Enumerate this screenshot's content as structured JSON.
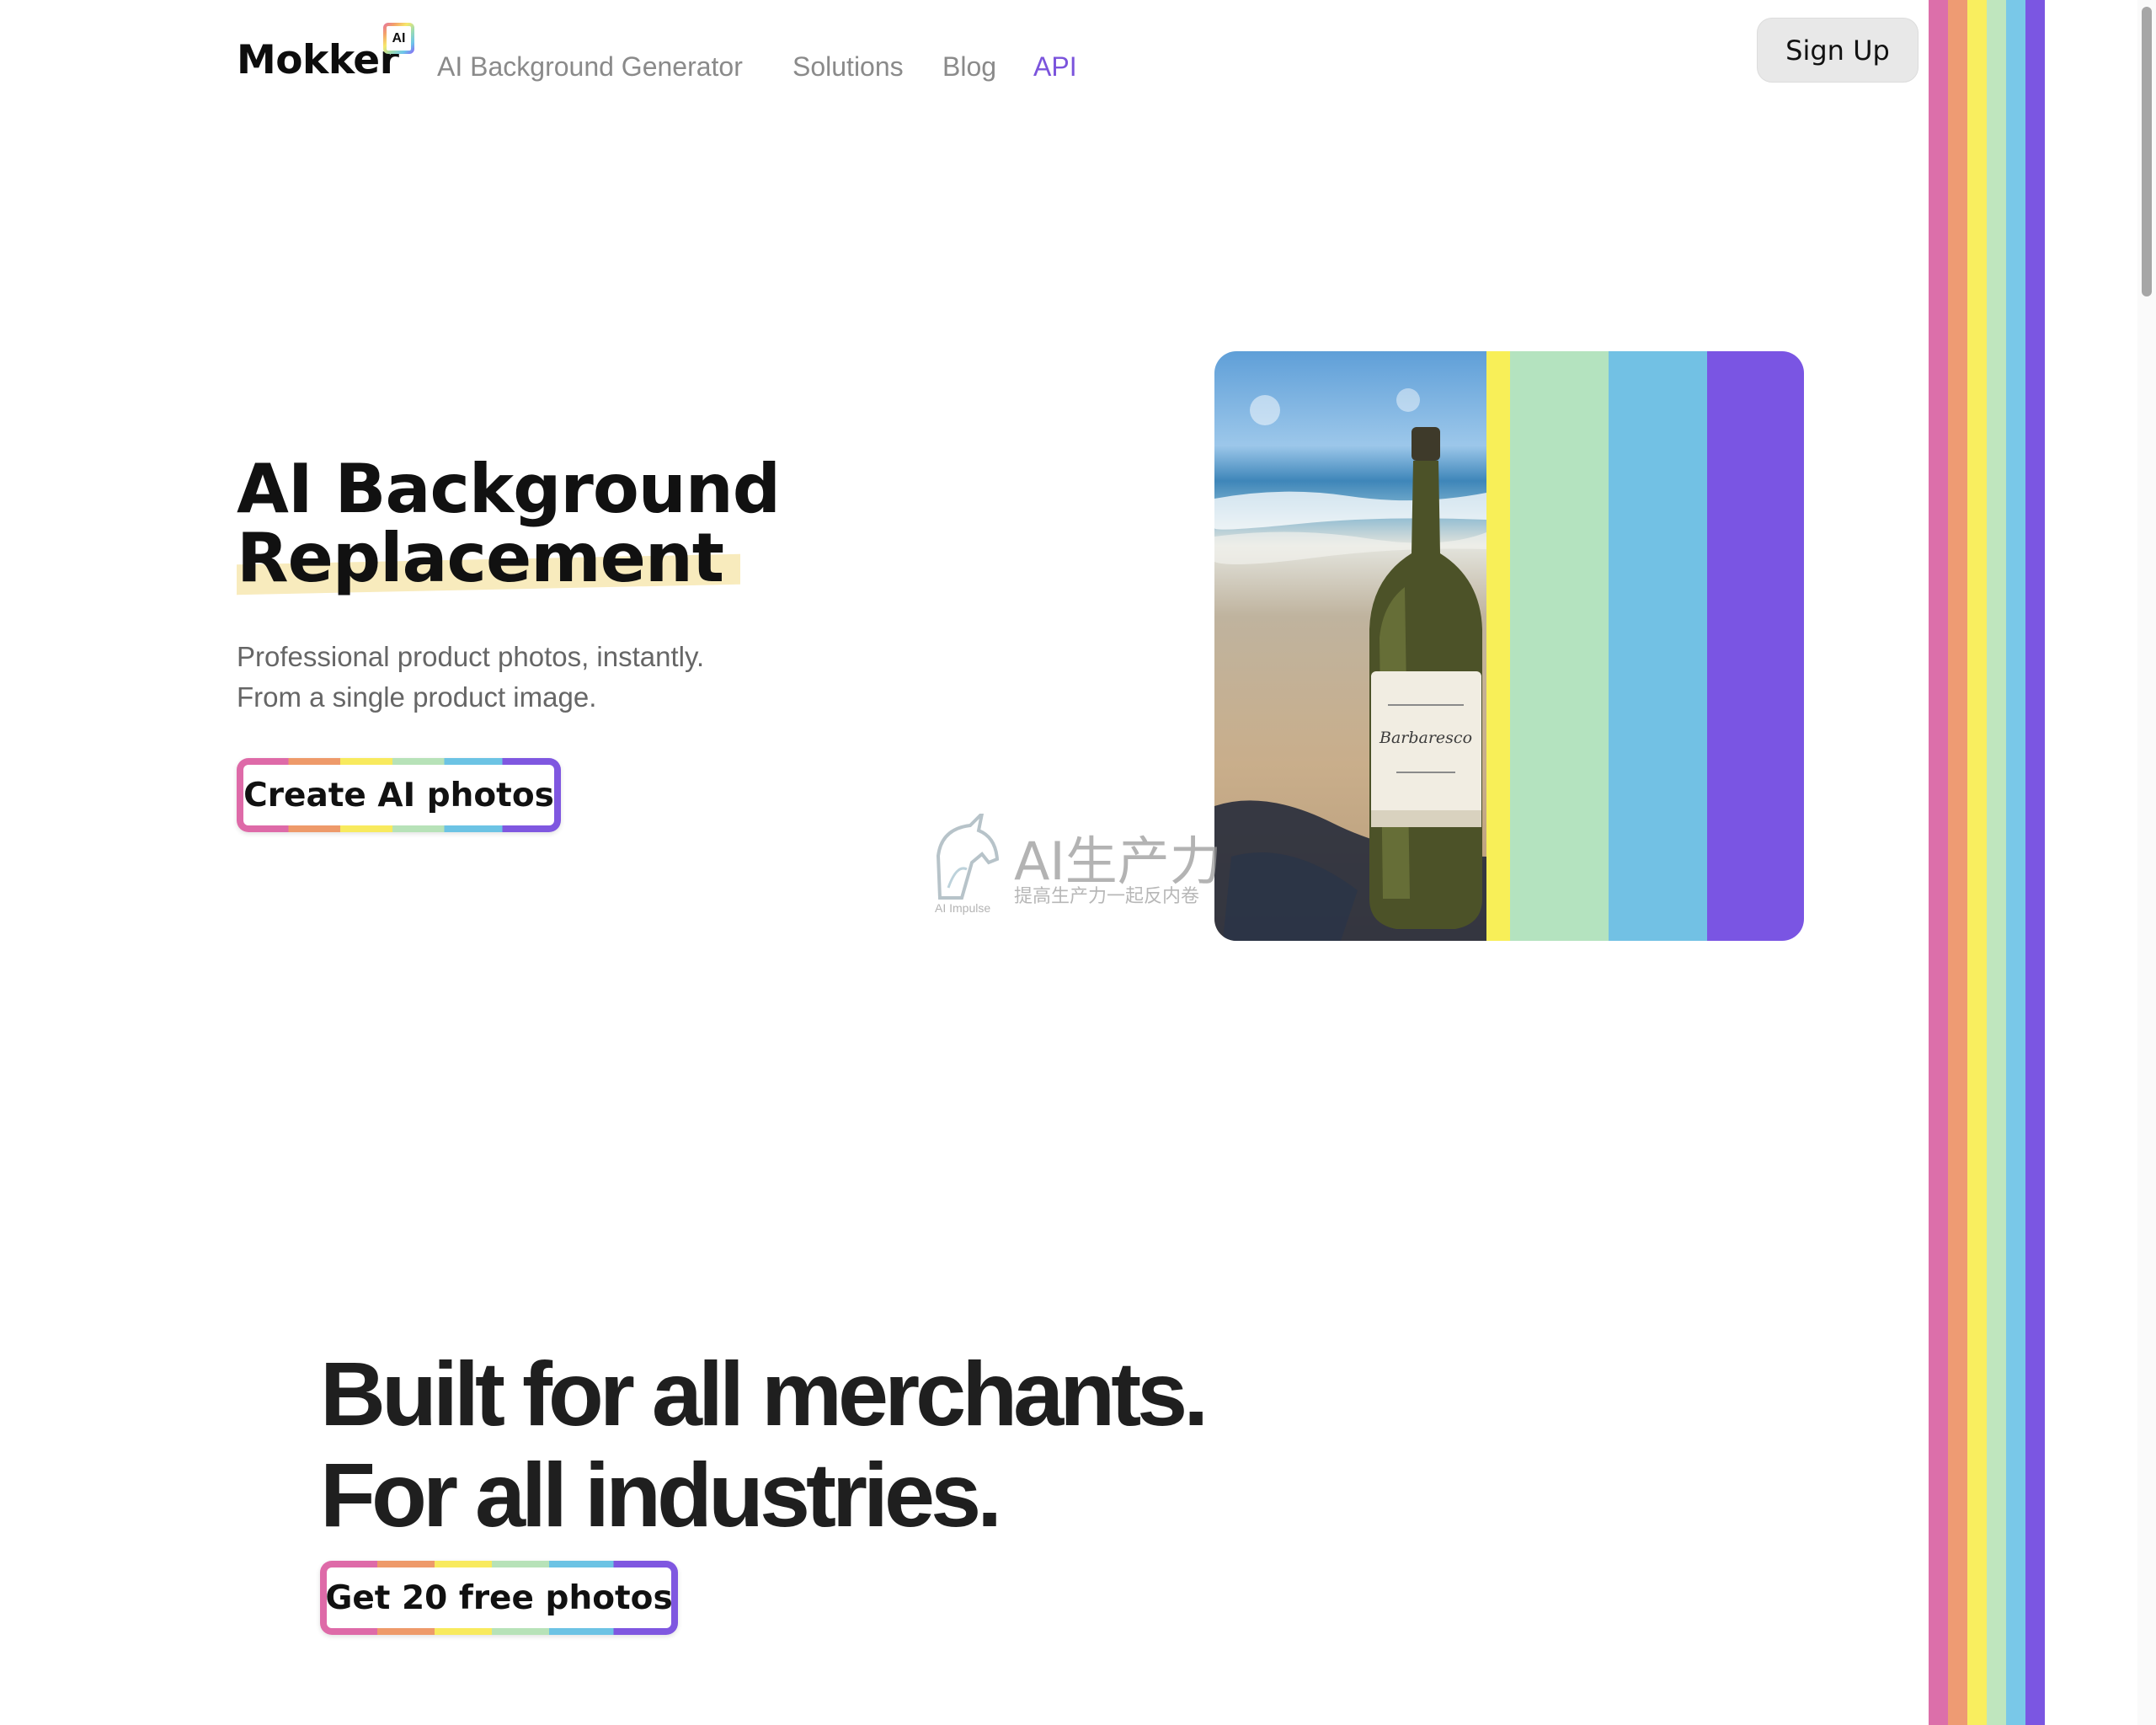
{
  "nav": {
    "logo": "Mokker",
    "logo_badge": "AI",
    "links": [
      "AI Background Generator",
      "Solutions",
      "Blog",
      "API"
    ],
    "signup": "Sign Up"
  },
  "hero": {
    "title_line1": "AI Background",
    "title_line2": "Replacement",
    "subtitle_line1": "Professional product photos, instantly.",
    "subtitle_line2": "From a single product image.",
    "cta": "Create AI photos"
  },
  "hero_image": {
    "bottle_label": "Barbaresco",
    "color_bars": [
      "#f8ef58",
      "#b4e3bf",
      "#72c1e4",
      "#7a55e3"
    ]
  },
  "watermark": {
    "title": "AI生产力",
    "subtitle": "提高生产力一起反内卷",
    "brand": "AI Impulse"
  },
  "section": {
    "line1": "Built for all merchants.",
    "line2": "For all industries.",
    "cta": "Get 20 free photos"
  },
  "side_rainbow_colors": [
    "#dc6faa",
    "#ee9b73",
    "#f9ee5f",
    "#bfe6be",
    "#79c8e8",
    "#7b56e2"
  ],
  "accent_color": "#7b54dc"
}
